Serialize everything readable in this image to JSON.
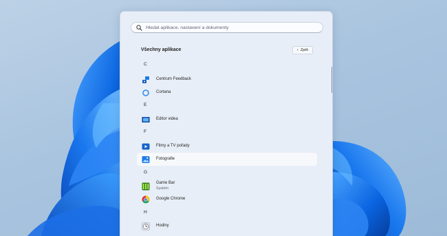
{
  "search": {
    "placeholder": "Hledat aplikace, nastavení a dokumenty"
  },
  "header": {
    "title": "Všechny aplikace",
    "back_label": "Zpět"
  },
  "apps": [
    {
      "type": "letter",
      "label": "C"
    },
    {
      "type": "app",
      "label": "Centrum Feedback",
      "icon": "feedback-hub-icon"
    },
    {
      "type": "app",
      "label": "Cortana",
      "icon": "cortana-icon"
    },
    {
      "type": "letter",
      "label": "E"
    },
    {
      "type": "app",
      "label": "Editor videa",
      "icon": "video-editor-icon"
    },
    {
      "type": "letter",
      "label": "F"
    },
    {
      "type": "app",
      "label": "Filmy a TV pořady",
      "icon": "movies-tv-icon"
    },
    {
      "type": "app",
      "label": "Fotografie",
      "icon": "photos-icon",
      "selected": true
    },
    {
      "type": "letter",
      "label": "G"
    },
    {
      "type": "app",
      "label": "Game Bar",
      "sublabel": "Systém",
      "icon": "game-bar-icon"
    },
    {
      "type": "app",
      "label": "Google Chrome",
      "icon": "chrome-icon"
    },
    {
      "type": "letter",
      "label": "H"
    },
    {
      "type": "app",
      "label": "Hodiny",
      "icon": "clock-icon"
    }
  ],
  "colors": {
    "accent": "#0067c0",
    "menu_background": "#e8eef7",
    "selected_row": "#f6f8fb"
  }
}
